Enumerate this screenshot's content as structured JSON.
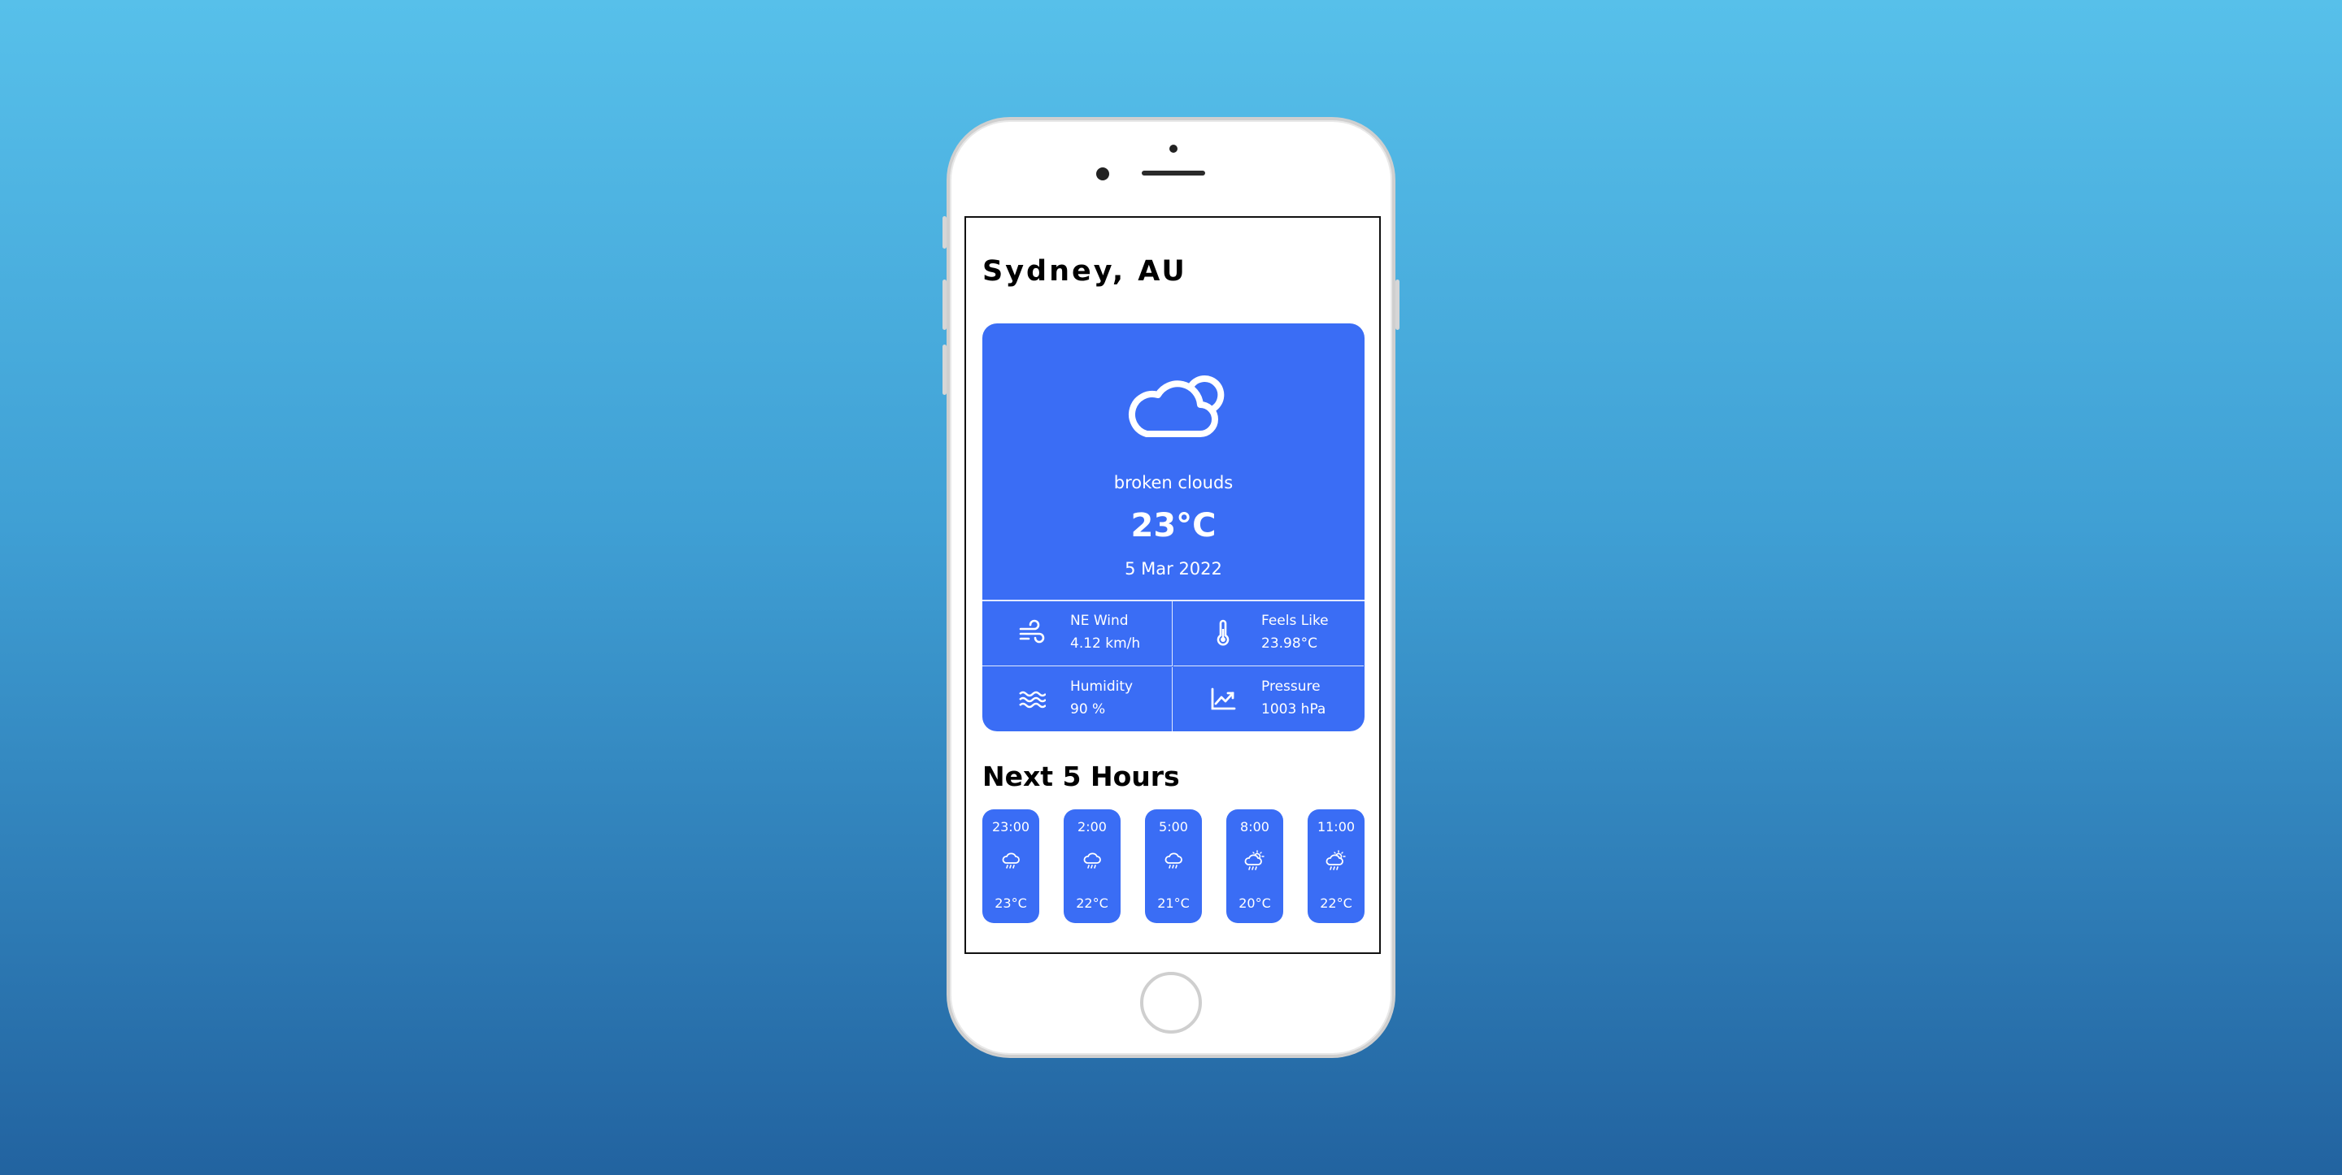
{
  "city": "Sydney, AU",
  "current": {
    "icon": "cloud-sun-icon",
    "description": "broken clouds",
    "temperature": "23°C",
    "date": "5 Mar 2022"
  },
  "details": [
    {
      "icon": "wind-icon",
      "label": "NE Wind",
      "value": "4.12 km/h"
    },
    {
      "icon": "thermometer-icon",
      "label": "Feels Like",
      "value": "23.98°C"
    },
    {
      "icon": "waves-icon",
      "label": "Humidity",
      "value": "90 %"
    },
    {
      "icon": "chart-line-icon",
      "label": "Pressure",
      "value": "1003 hPa"
    }
  ],
  "forecast": {
    "title": "Next 5 Hours",
    "hours": [
      {
        "time": "23:00",
        "icon": "cloud-rain-icon",
        "temp": "23°C"
      },
      {
        "time": "2:00",
        "icon": "cloud-rain-icon",
        "temp": "22°C"
      },
      {
        "time": "5:00",
        "icon": "cloud-rain-icon",
        "temp": "21°C"
      },
      {
        "time": "8:00",
        "icon": "sun-cloud-rain-icon",
        "temp": "20°C"
      },
      {
        "time": "11:00",
        "icon": "sun-cloud-rain-icon",
        "temp": "22°C"
      }
    ]
  },
  "colors": {
    "card": "#3a6df5",
    "text": "#000000"
  }
}
